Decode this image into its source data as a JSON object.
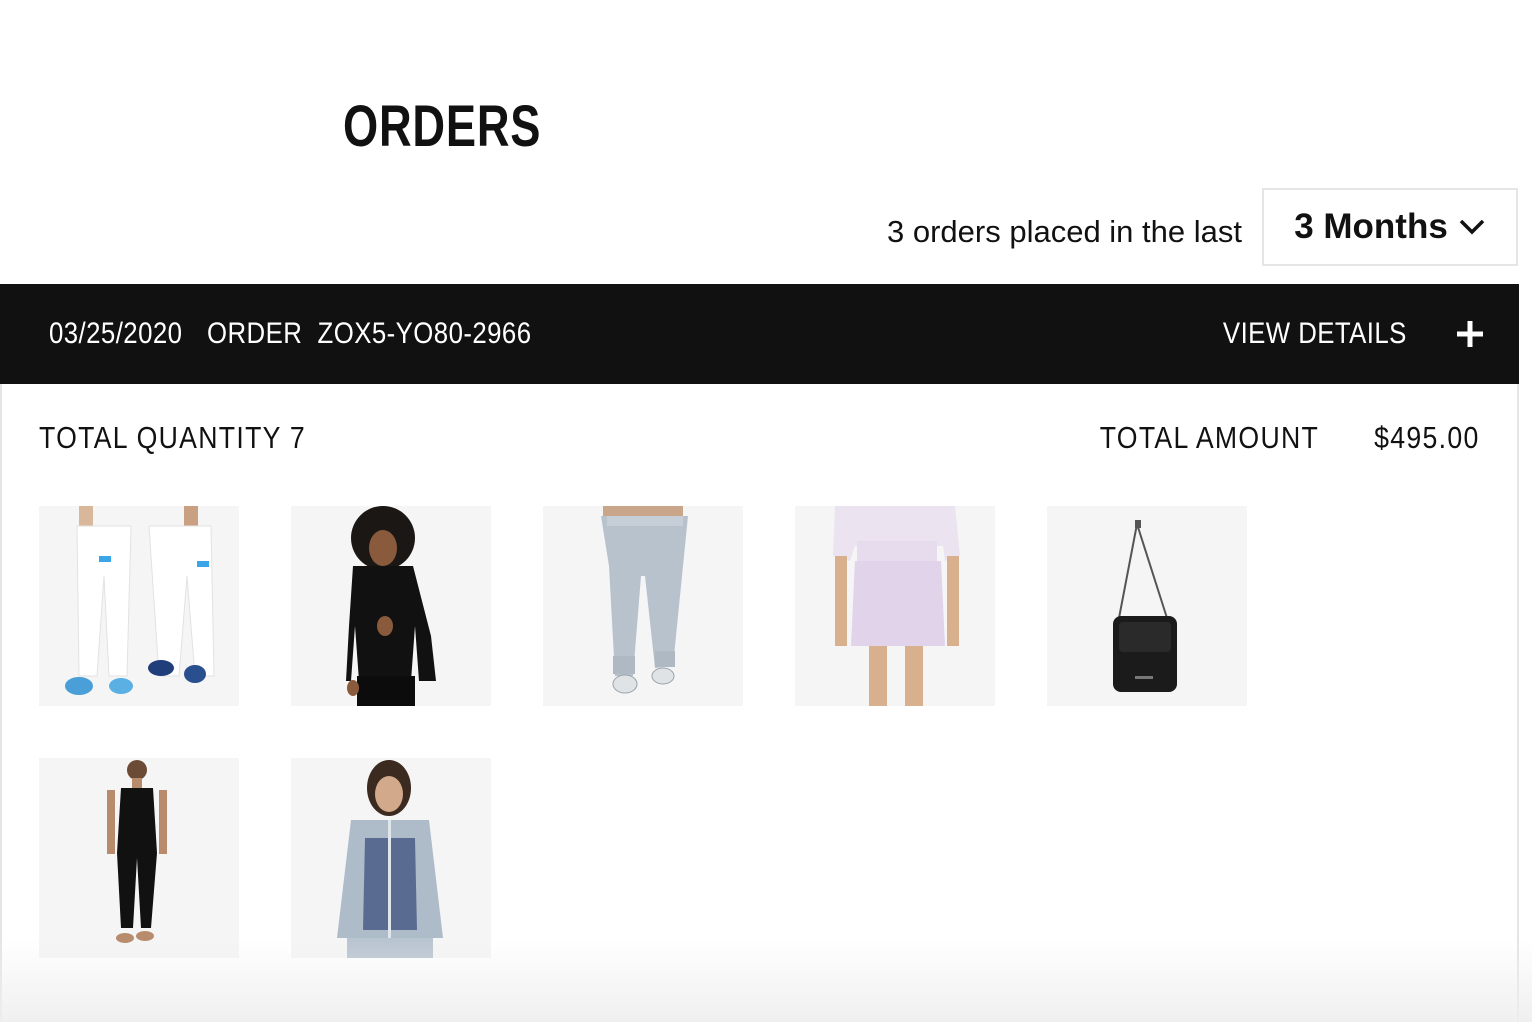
{
  "page": {
    "title": "ORDERS"
  },
  "filter": {
    "summary_text": "3 orders placed in the last",
    "selected_period": "3 Months"
  },
  "order": {
    "date": "03/25/2020",
    "order_label": "ORDER",
    "order_number": "ZOX5-YO80-2966",
    "view_details_label": "VIEW DETAILS",
    "total_quantity_text": "TOTAL QUANTITY 7",
    "total_amount_label": "TOTAL AMOUNT",
    "total_amount_value": "$495.00",
    "items": [
      {
        "name": "white-joggers-pair",
        "icon": "white-joggers-image"
      },
      {
        "name": "black-hoodie",
        "icon": "black-hoodie-image"
      },
      {
        "name": "grey-joggers",
        "icon": "grey-joggers-image"
      },
      {
        "name": "lavender-skirt",
        "icon": "lavender-skirt-image"
      },
      {
        "name": "black-crossbody-bag",
        "icon": "crossbody-bag-image"
      },
      {
        "name": "black-jumpsuit",
        "icon": "black-jumpsuit-image"
      },
      {
        "name": "blue-grey-jacket",
        "icon": "blue-jacket-image"
      }
    ]
  },
  "colors": {
    "bar_background": "#111111",
    "thumb_background": "#f5f5f5",
    "border": "#e5e5e5"
  }
}
